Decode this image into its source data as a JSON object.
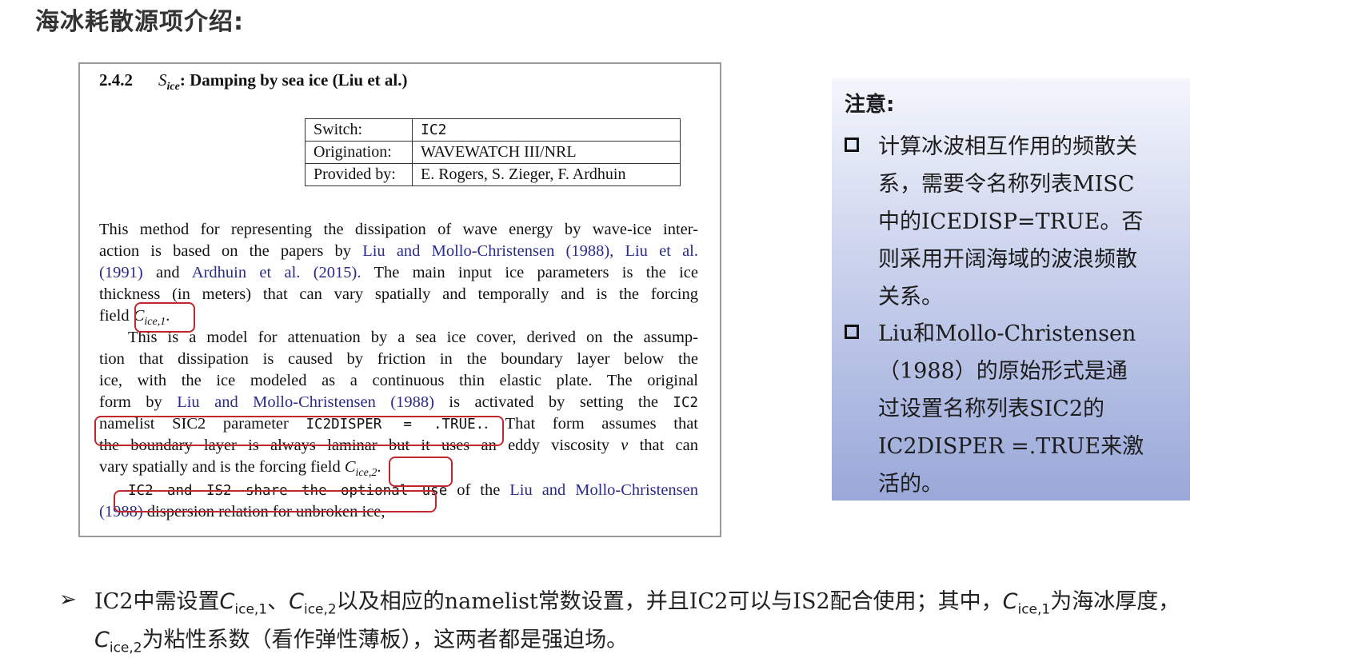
{
  "slide_title": "海冰耗散源项介绍:",
  "paper": {
    "section_number": "2.4.2",
    "section_symbol": "S",
    "section_symbol_sub": "ice",
    "section_title": ": Damping by sea ice (Liu et al.)",
    "table": [
      {
        "key": "Switch:",
        "value": "IC2"
      },
      {
        "key": "Origination:",
        "value": "WAVEWATCH III/NRL"
      },
      {
        "key": "Provided by:",
        "value": "E. Rogers, S. Zieger, F. Ardhuin"
      }
    ],
    "p1": {
      "l1": "This method for representing the dissipation of wave energy by wave-ice inter-",
      "l2a": "action is based on the papers by",
      "l2b": "Liu and Mollo-Christensen (1988),",
      "l2c": "Liu et al.",
      "l3a": "(1991)",
      "l3b": "and",
      "l3c": "Ardhuin et al. (2015).",
      "l3d": "The main input ice parameters is the ice",
      "l4": "thickness (in meters) that can vary spatially and temporally and is the forcing",
      "l5a": "field",
      "l5_sym": "C",
      "l5_sub": "ice,1",
      "l5b": "."
    },
    "p2": {
      "l1": "This is a model for attenuation by a sea ice cover, derived on the assump-",
      "l2": "tion that dissipation is caused by friction in the boundary layer below the",
      "l3": "ice, with the ice modeled as a continuous thin elastic plate.  The original",
      "l4a": "form by",
      "l4b": "Liu and Mollo-Christensen (1988)",
      "l4c": "is activated by setting the",
      "l4d": "IC2",
      "l5a": "namelist SIC2 parameter",
      "l5b": "IC2DISPER = .TRUE.",
      "l5c": ".  That form assumes that",
      "l6a": "the boundary layer is always laminar but it uses an eddy viscosity",
      "l6_nu": "ν",
      "l6b": "that can",
      "l7a": "vary spatially and is the forcing field",
      "l7_sym": "C",
      "l7_sub": "ice,2",
      "l7b": "."
    },
    "p3": {
      "l1a": "IC2 and IS2 share the optional use",
      "l1b": "of the",
      "l1c": "Liu and Mollo-Christensen",
      "l2a": "(1988)",
      "l2b": "dispersion relation for unbroken ice,"
    }
  },
  "note": {
    "title": "注意:",
    "item1_lines": [
      "计算冰波相互作用的频散关",
      "系，需要令名称列表MISC",
      "中的ICEDISP=TRUE。否",
      "则采用开阔海域的波浪频散",
      "关系。"
    ],
    "item2_lines": [
      "Liu和Mollo-Christensen",
      "（1988）的原始形式是通",
      "过设置名称列表SIC2的",
      "IC2DISPER =.TRUE来激",
      "活的。"
    ]
  },
  "bottom": {
    "arrow": "➢",
    "l1a": "IC2中需设置",
    "sym": "C",
    "sub1": "ice,1",
    "l1b": "、",
    "sub2": "ice,2",
    "l1c": "以及相应的namelist常数设置，并且IC2可以与IS2配合使用；其中，",
    "l1d": "为海冰厚度，",
    "l2a": "为粘性系数（看作弹性薄板），这两者都是强迫场。"
  }
}
